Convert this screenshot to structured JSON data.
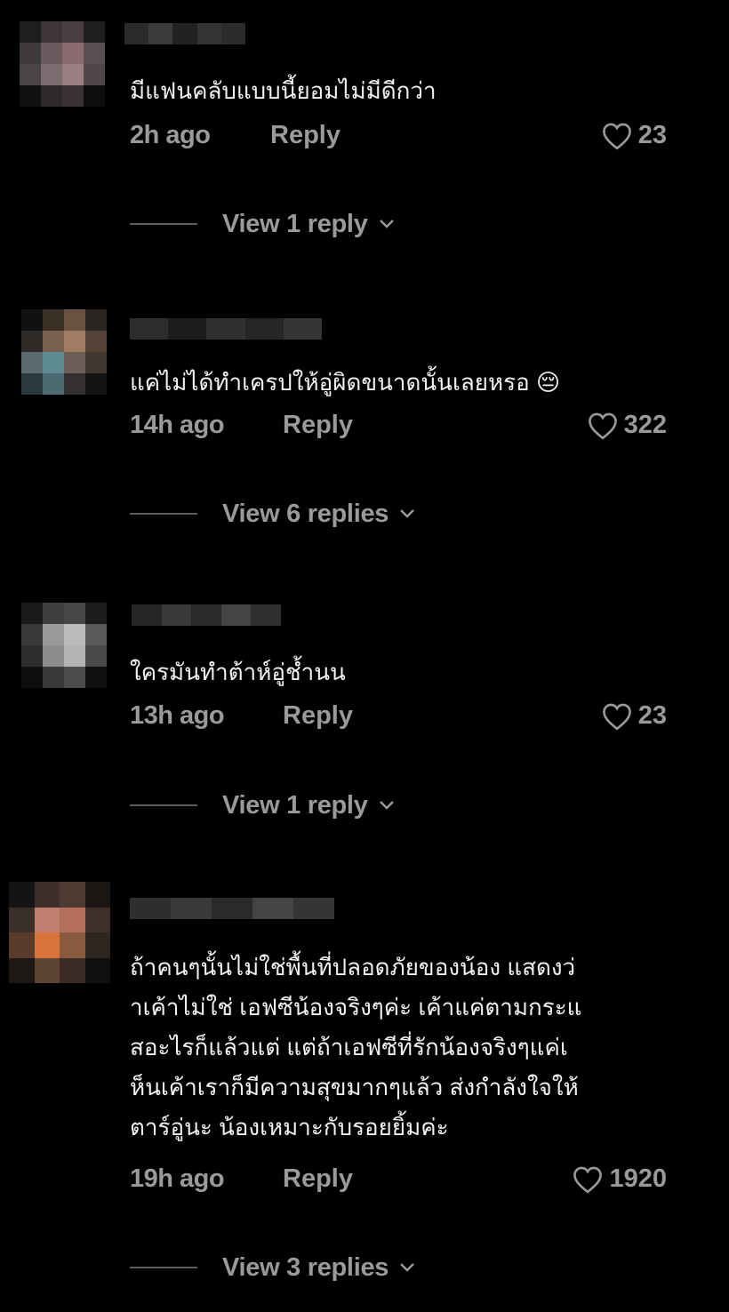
{
  "comments": [
    {
      "text": "มีแฟนคลับแบบนี้ยอมไม่มีดีกว่า",
      "time": "2h ago",
      "reply_label": "Reply",
      "likes": "23",
      "view_replies": "View 1 reply"
    },
    {
      "text": "แค่ไม่ได้ทำเครปให้อู่ผิดขนาดนั้นเลยหรอ 😔",
      "time": "14h ago",
      "reply_label": "Reply",
      "likes": "322",
      "view_replies": "View 6 replies"
    },
    {
      "text": "ใครมันทำต้าห์อู่ช้ำนน",
      "time": "13h ago",
      "reply_label": "Reply",
      "likes": "23",
      "view_replies": "View 1 reply"
    },
    {
      "text": "ถ้าคนๆนั้นไม่ใช่พื้นที่ปลอดภัยของน้อง แสดงว่\nาเค้าไม่ใช่ เอฟซีน้องจริงๆค่ะ เค้าแค่ตามกระแ\nสอะไรก็แล้วแต่ แต่ถ้าเอฟซีที่รักน้องจริงๆแค่เ\nห็นเค้าเราก็มีความสุขมากๆแล้ว ส่งกำลังใจให้\nตาร์อู่นะ น้องเหมาะกับรอยยิ้มค่ะ",
      "time": "19h ago",
      "reply_label": "Reply",
      "likes": "1920",
      "view_replies": "View 3 replies"
    }
  ],
  "icons": {
    "like": "heart-outline-icon",
    "expand": "chevron-down-icon"
  },
  "colors": {
    "background": "#000000",
    "text": "#f2f2f2",
    "muted": "#9a9a9a",
    "divider": "#5e5e5e"
  }
}
